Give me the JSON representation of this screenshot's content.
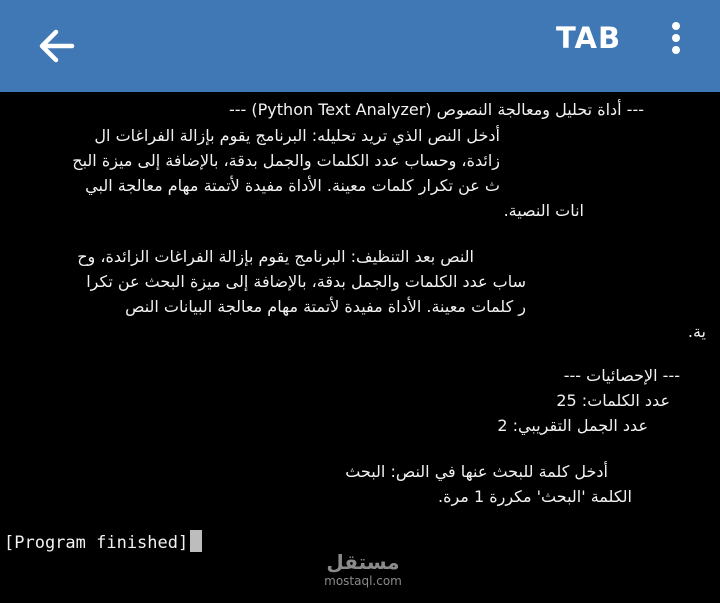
{
  "appbar": {
    "back_icon": "arrow-left-icon",
    "tab_label": "TAB",
    "menu_icon": "more-vert-icon"
  },
  "terminal": {
    "header": "--- أداة تحليل ومعالجة النصوص (Python Text Analyzer) ---",
    "prompt_lines": [
      "أدخل النص الذي تريد تحليله: البرنامج يقوم بإزالة الفراغات ال",
      "زائدة، وحساب عدد الكلمات والجمل بدقة، بالإضافة إلى ميزة البح",
      "ث عن تكرار كلمات معينة. الأداة مفيدة لأتمتة مهام معالجة البي",
      "انات النصية."
    ],
    "cleaned_lines": [
      "النص بعد التنظيف: البرنامج يقوم بإزالة الفراغات الزائدة، وح",
      "ساب عدد الكلمات والجمل بدقة، بالإضافة إلى ميزة البحث عن تكرا",
      "ر كلمات معينة. الأداة مفيدة لأتمتة مهام معالجة البيانات النص",
      "ية."
    ],
    "stats_header": "--- الإحصائيات ---",
    "word_count": "عدد الكلمات: 25",
    "sentence_count": "عدد الجمل التقريبي: 2",
    "search_prompt": "أدخل كلمة للبحث عنها في النص: البحث",
    "search_result": "الكلمة 'البحث' مكررة 1 مرة.",
    "finished": "[Program finished]"
  },
  "watermark": {
    "logo": "مستقل",
    "sub": "mostaql.com"
  }
}
